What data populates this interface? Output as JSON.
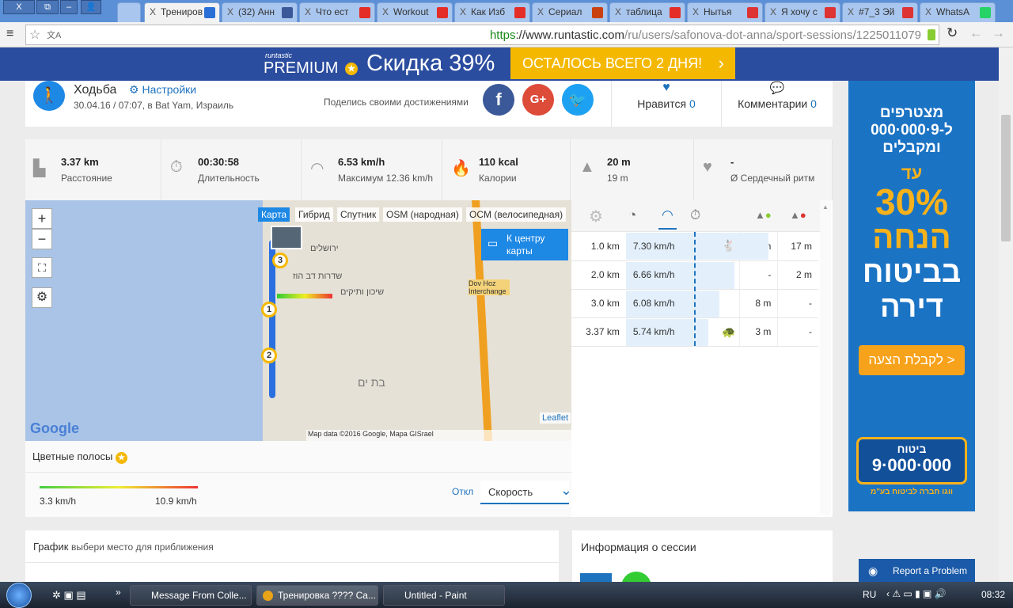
{
  "browser": {
    "tabs": [
      {
        "label": "Трениров",
        "icon": "runtastic-icon",
        "color": "#2a6fd6",
        "active": true
      },
      {
        "label": "(32) Анн",
        "icon": "facebook-icon",
        "color": "#3b5998"
      },
      {
        "label": "Что ест",
        "icon": "youtube-icon",
        "color": "#e52d27"
      },
      {
        "label": "Workout",
        "icon": "youtube-icon",
        "color": "#e52d27"
      },
      {
        "label": "Как Изб",
        "icon": "youtube-icon",
        "color": "#e52d27"
      },
      {
        "label": "Сериал",
        "icon": "vc-icon",
        "color": "#c8410f"
      },
      {
        "label": "таблица",
        "icon": "yandex-icon",
        "color": "#e52d27"
      },
      {
        "label": "Нытья",
        "icon": "shield-icon",
        "color": "#d33"
      },
      {
        "label": "Я хочу с",
        "icon": "shield-icon",
        "color": "#d33"
      },
      {
        "label": "#7_3 Эй",
        "icon": "shield-icon",
        "color": "#d33"
      },
      {
        "label": "WhatsA",
        "icon": "whatsapp-icon",
        "color": "#25d366"
      }
    ],
    "url_scheme": "https",
    "url_host": "://www.runtastic.com",
    "url_path": "/ru/users/safonova-dot-anna/sport-sessions/1225011079"
  },
  "banner": {
    "brand": "runtastic",
    "premium": "PREMIUM",
    "discount": "Скидка 39%",
    "cta": "ОСТАЛОСЬ ВСЕГО 2 ДНЯ!"
  },
  "session": {
    "sport": "Ходьба",
    "settings": "Настройки",
    "datetime": "30.04.16 / 07:07, в Bat Yam, Израиль",
    "share_label": "Поделись своими достижениями",
    "likes_label": "Нравится",
    "likes_count": "0",
    "comments_label": "Комментарии",
    "comments_count": "0"
  },
  "stats": [
    {
      "value": "3.37 km",
      "label": "Расстояние",
      "icon": "road-icon"
    },
    {
      "value": "00:30:58",
      "label": "Длительность",
      "icon": "stopwatch-icon"
    },
    {
      "value": "6.53 km/h",
      "label": "Максимум 12.36 km/h",
      "icon": "speedometer-icon"
    },
    {
      "value": "110 kcal",
      "label": "Калории",
      "icon": "flame-icon"
    },
    {
      "value": "20 m",
      "label": "19 m",
      "icon": "elevation-icon"
    },
    {
      "value": "-",
      "label": "Ø Сердечный ритм",
      "icon": "heart-icon"
    }
  ],
  "map": {
    "layers": [
      "Карта",
      "Гибрид",
      "Спутник",
      "OSM (народная)",
      "OCM (велосипедная)"
    ],
    "center_button": "К центру карты",
    "zoom_in": "+",
    "zoom_out": "−",
    "markers": [
      "1",
      "2",
      "3"
    ],
    "attribution": "Map data ©2016 Google, Mapa GISrael",
    "leaflet": "Leaflet",
    "google": "Google",
    "labels": [
      "Dov Hoz Interchange",
      "בת ים",
      "ירושלים",
      "שדרות דב הוז",
      "שיכון ותיקים"
    ]
  },
  "splits": [
    {
      "distance": "1.0 km",
      "speed": "7.30 km/h",
      "speed_pct": 100,
      "badge": "rabbit",
      "up": "9 m",
      "down": "17 m"
    },
    {
      "distance": "2.0 km",
      "speed": "6.66 km/h",
      "speed_pct": 55,
      "badge": "",
      "up": "-",
      "down": "2 m"
    },
    {
      "distance": "3.0 km",
      "speed": "6.08 km/h",
      "speed_pct": 35,
      "badge": "",
      "up": "8 m",
      "down": "-"
    },
    {
      "distance": "3.37 km",
      "speed": "5.74 km/h",
      "speed_pct": 20,
      "badge": "turtle",
      "up": "3 m",
      "down": "-"
    }
  ],
  "colorbars": {
    "title": "Цветные полосы",
    "min": "3.3 km/h",
    "max": "10.9 km/h",
    "off": "Откл",
    "selected": "Скорость"
  },
  "graph": {
    "title": "График",
    "hint": "выбери место для приближения"
  },
  "session_info": {
    "title": "Информация о сессии"
  },
  "ad": {
    "line1": "מצטרפים",
    "line2": "ל-9·000·000",
    "line3": "ומקבלים",
    "line4": "עד",
    "big": "30%",
    "line5": "הנחה",
    "line6": "בביטוח",
    "line7": "דירה",
    "cta": "לקבלת הצעה >",
    "logo_top": "ביטוח",
    "logo_num": "9·000·000",
    "footer": "ווגו חברה לביטוח בע\"מ"
  },
  "report": "Report a Problem",
  "taskbar": {
    "items": [
      "Message From Colle...",
      "Тренировка ???? Ca...",
      "Untitled - Paint"
    ],
    "lang": "RU",
    "time": "08:32"
  }
}
